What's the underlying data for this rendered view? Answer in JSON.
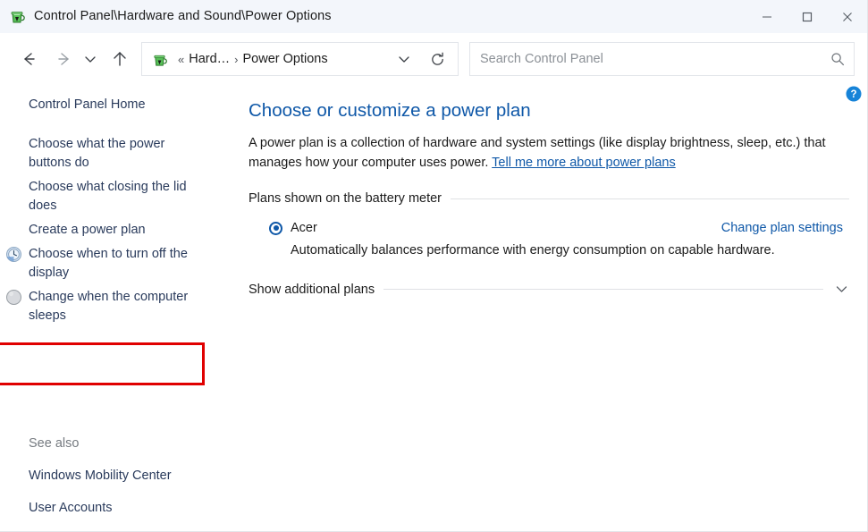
{
  "window": {
    "title": "Control Panel\\Hardware and Sound\\Power Options",
    "title_icon": "power-plug-icon",
    "minimize_label": "Minimize",
    "maximize_label": "Maximize",
    "close_label": "Close"
  },
  "nav": {
    "back_label": "Back",
    "forward_label": "Forward",
    "recent_label": "Recent locations",
    "up_label": "Up",
    "address": {
      "icon": "power-plug-icon",
      "separator_first": "«",
      "crumbs": [
        "Hard…",
        "Power Options"
      ],
      "crumb_separator": "›",
      "dropdown_label": "Previous locations",
      "refresh_label": "Refresh"
    },
    "search": {
      "placeholder": "Search Control Panel",
      "value": "",
      "icon": "search-icon"
    }
  },
  "sidebar": {
    "home_label": "Control Panel Home",
    "items": [
      {
        "label": "Choose what the power buttons do",
        "icon": null
      },
      {
        "label": "Choose what closing the lid does",
        "icon": null
      },
      {
        "label": "Create a power plan",
        "icon": null
      },
      {
        "label": "Choose when to turn off the display",
        "icon": "clock-icon",
        "highlighted": true
      },
      {
        "label": "Change when the computer sleeps",
        "icon": "moon-icon"
      }
    ],
    "see_also": {
      "title": "See also",
      "items": [
        "Windows Mobility Center",
        "User Accounts"
      ]
    },
    "highlight_color": "#e00000"
  },
  "main": {
    "help_label": "Help",
    "title": "Choose or customize a power plan",
    "intro_text": "A power plan is a collection of hardware and system settings (like display brightness, sleep, etc.) that manages how your computer uses power. ",
    "intro_link": "Tell me more about power plans",
    "battery_section_label": "Plans shown on the battery meter",
    "plan": {
      "name": "Acer",
      "selected": true,
      "description": "Automatically balances performance with energy consumption on capable hardware.",
      "change_settings_label": "Change plan settings"
    },
    "additional_plans_label": "Show additional plans",
    "additional_plans_expanded": false,
    "accent_color": "#0f58a8"
  }
}
